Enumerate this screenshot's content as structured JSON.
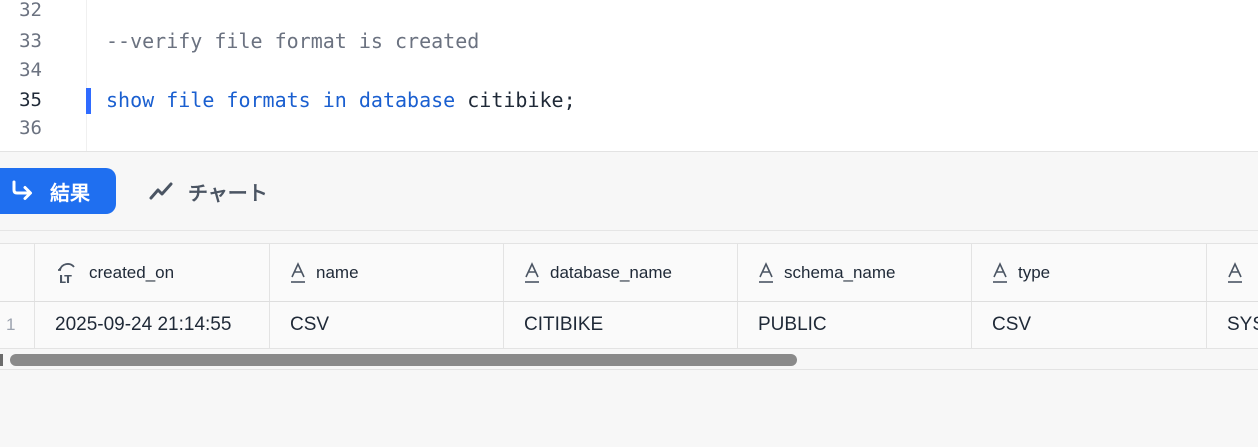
{
  "editor": {
    "lines": [
      {
        "num": "32",
        "text": ""
      },
      {
        "num": "33",
        "text": "--verify file format is created"
      },
      {
        "num": "34",
        "text": ""
      },
      {
        "num": "35",
        "kw": "show file formats in database",
        "ident": " citibike;"
      },
      {
        "num": "36",
        "text": ""
      }
    ]
  },
  "tabs": {
    "results_label": "結果",
    "chart_label": "チャート"
  },
  "grid": {
    "columns": [
      "created_on",
      "name",
      "database_name",
      "schema_name",
      "type",
      ""
    ],
    "column_types": [
      "timestamp-icon",
      "text-type-icon",
      "text-type-icon",
      "text-type-icon",
      "text-type-icon",
      "text-type-icon"
    ],
    "rows": [
      {
        "num": "1",
        "cells": [
          "2025-09-24 21:14:55",
          "CSV",
          "CITIBIKE",
          "PUBLIC",
          "CSV",
          "SYS"
        ]
      }
    ]
  },
  "colors": {
    "accent": "#1f6ff0",
    "keyword": "#1a5fd0",
    "comment": "#6b7280"
  }
}
